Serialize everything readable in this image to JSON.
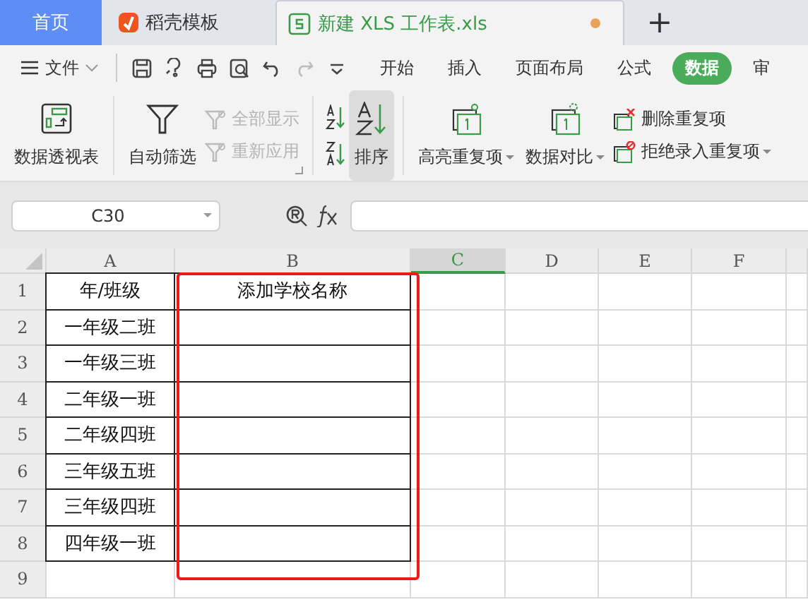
{
  "tabs": [
    {
      "label": "首页",
      "kind": "home",
      "selected": false,
      "unsaved": false
    },
    {
      "label": "稻壳模板",
      "kind": "docer",
      "selected": false,
      "unsaved": false
    },
    {
      "label": "新建 XLS 工作表.xls",
      "kind": "sheet",
      "selected": true,
      "unsaved": true
    }
  ],
  "new_tab": "+",
  "menu": {
    "file": "文件",
    "items": [
      {
        "label": "开始",
        "selected": false
      },
      {
        "label": "插入",
        "selected": false
      },
      {
        "label": "页面布局",
        "selected": false
      },
      {
        "label": "公式",
        "selected": false
      },
      {
        "label": "数据",
        "selected": true
      },
      {
        "label": "审",
        "selected": false
      }
    ]
  },
  "ribbon": {
    "pivot": {
      "label": "数据透视表"
    },
    "filter": {
      "label": "自动筛选"
    },
    "filter_options": [
      {
        "label": "全部显示",
        "disabled": true
      },
      {
        "label": "重新应用",
        "disabled": true
      }
    ],
    "sort": {
      "label": "排序",
      "highlighted": true
    },
    "duplicates": [
      {
        "label": "高亮重复项",
        "kind": "large"
      },
      {
        "label": "数据对比",
        "kind": "large"
      }
    ],
    "duplicate_actions": [
      {
        "label": "删除重复项",
        "dropdown": false
      },
      {
        "label": "拒绝录入重复项",
        "dropdown": true
      }
    ]
  },
  "name_box": {
    "value": "C30"
  },
  "columns": [
    {
      "label": "A",
      "selected": false
    },
    {
      "label": "B",
      "selected": false
    },
    {
      "label": "C",
      "selected": true
    },
    {
      "label": "D",
      "selected": false
    },
    {
      "label": "E",
      "selected": false
    },
    {
      "label": "F",
      "selected": false
    }
  ],
  "rows": [
    {
      "label": "1",
      "bordered": true,
      "cells": [
        "年/班级",
        "添加学校名称"
      ]
    },
    {
      "label": "2",
      "bordered": true,
      "cells": [
        "一年级二班",
        ""
      ]
    },
    {
      "label": "3",
      "bordered": true,
      "cells": [
        "一年级三班",
        ""
      ]
    },
    {
      "label": "4",
      "bordered": true,
      "cells": [
        "二年级一班",
        ""
      ]
    },
    {
      "label": "5",
      "bordered": true,
      "cells": [
        "二年级四班",
        ""
      ]
    },
    {
      "label": "6",
      "bordered": true,
      "cells": [
        "三年级五班",
        ""
      ]
    },
    {
      "label": "7",
      "bordered": true,
      "cells": [
        "三年级四班",
        ""
      ]
    },
    {
      "label": "8",
      "bordered": true,
      "cells": [
        "四年级一班",
        ""
      ]
    },
    {
      "label": "9",
      "bordered": false,
      "cells": [
        "",
        ""
      ]
    }
  ]
}
